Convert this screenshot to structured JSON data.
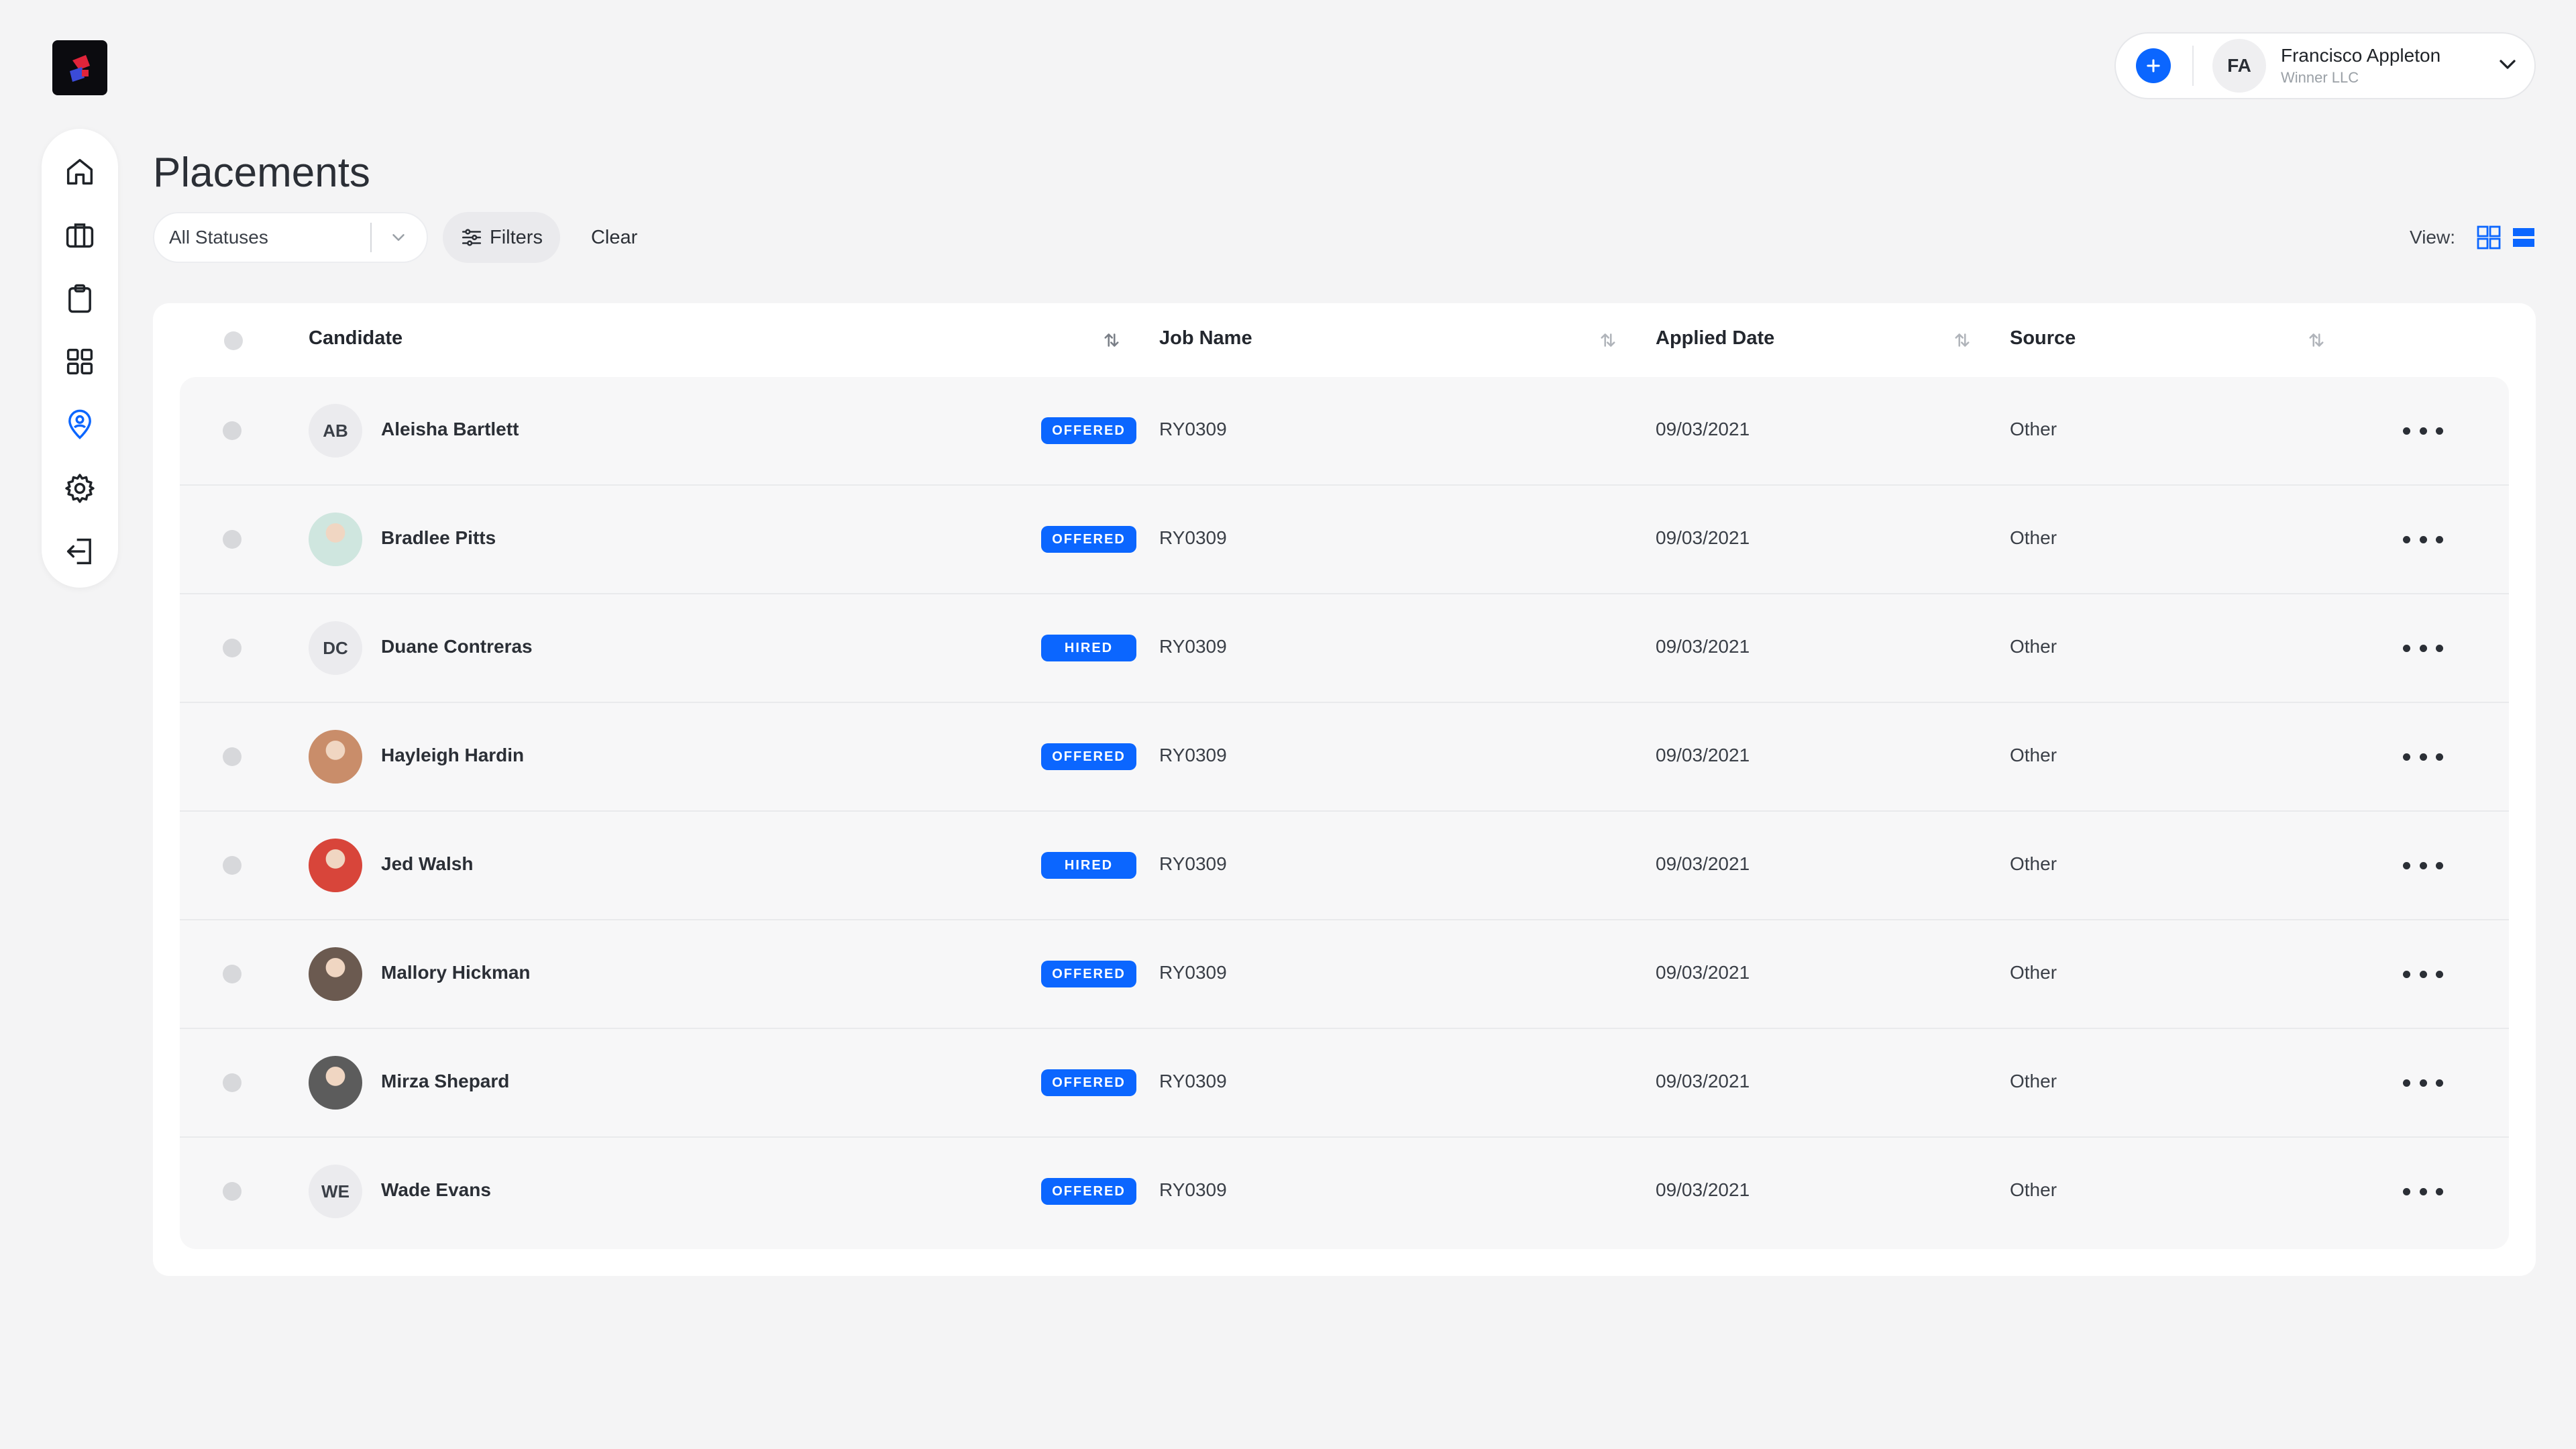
{
  "header": {
    "title": "Placements",
    "account": {
      "initials": "FA",
      "name": "Francisco Appleton",
      "org": "Winner LLC"
    }
  },
  "sidebar": {
    "items": [
      {
        "name": "home",
        "icon": "home-icon"
      },
      {
        "name": "jobs",
        "icon": "briefcase-icon"
      },
      {
        "name": "tasks",
        "icon": "clipboard-icon"
      },
      {
        "name": "apps",
        "icon": "grid-icon"
      },
      {
        "name": "placements",
        "icon": "location-person-icon",
        "active": true
      },
      {
        "name": "settings",
        "icon": "gear-icon"
      },
      {
        "name": "logout",
        "icon": "logout-icon"
      }
    ]
  },
  "toolbar": {
    "status_value": "All Statuses",
    "filters_label": "Filters",
    "clear_label": "Clear",
    "view_label": "View:"
  },
  "table": {
    "columns": [
      "Candidate",
      "Job Name",
      "Applied Date",
      "Source"
    ],
    "rows": [
      {
        "initials": "AB",
        "photo": false,
        "name": "Aleisha Bartlett",
        "status": "OFFERED",
        "job": "RY0309",
        "date": "09/03/2021",
        "source": "Other"
      },
      {
        "initials": "",
        "photo": true,
        "photo_color": "#cfe6df",
        "name": "Bradlee Pitts",
        "status": "OFFERED",
        "job": "RY0309",
        "date": "09/03/2021",
        "source": "Other"
      },
      {
        "initials": "DC",
        "photo": false,
        "name": "Duane Contreras",
        "status": "HIRED",
        "job": "RY0309",
        "date": "09/03/2021",
        "source": "Other"
      },
      {
        "initials": "",
        "photo": true,
        "photo_color": "#c98d6a",
        "name": "Hayleigh Hardin",
        "status": "OFFERED",
        "job": "RY0309",
        "date": "09/03/2021",
        "source": "Other"
      },
      {
        "initials": "",
        "photo": true,
        "photo_color": "#d8453a",
        "name": "Jed Walsh",
        "status": "HIRED",
        "job": "RY0309",
        "date": "09/03/2021",
        "source": "Other"
      },
      {
        "initials": "",
        "photo": true,
        "photo_color": "#6b5a50",
        "name": "Mallory Hickman",
        "status": "OFFERED",
        "job": "RY0309",
        "date": "09/03/2021",
        "source": "Other"
      },
      {
        "initials": "",
        "photo": true,
        "photo_color": "#5c5c5c",
        "name": "Mirza Shepard",
        "status": "OFFERED",
        "job": "RY0309",
        "date": "09/03/2021",
        "source": "Other"
      },
      {
        "initials": "WE",
        "photo": false,
        "name": "Wade Evans",
        "status": "OFFERED",
        "job": "RY0309",
        "date": "09/03/2021",
        "source": "Other"
      }
    ]
  },
  "colors": {
    "accent": "#0b66ff",
    "background": "#f4f4f5"
  }
}
